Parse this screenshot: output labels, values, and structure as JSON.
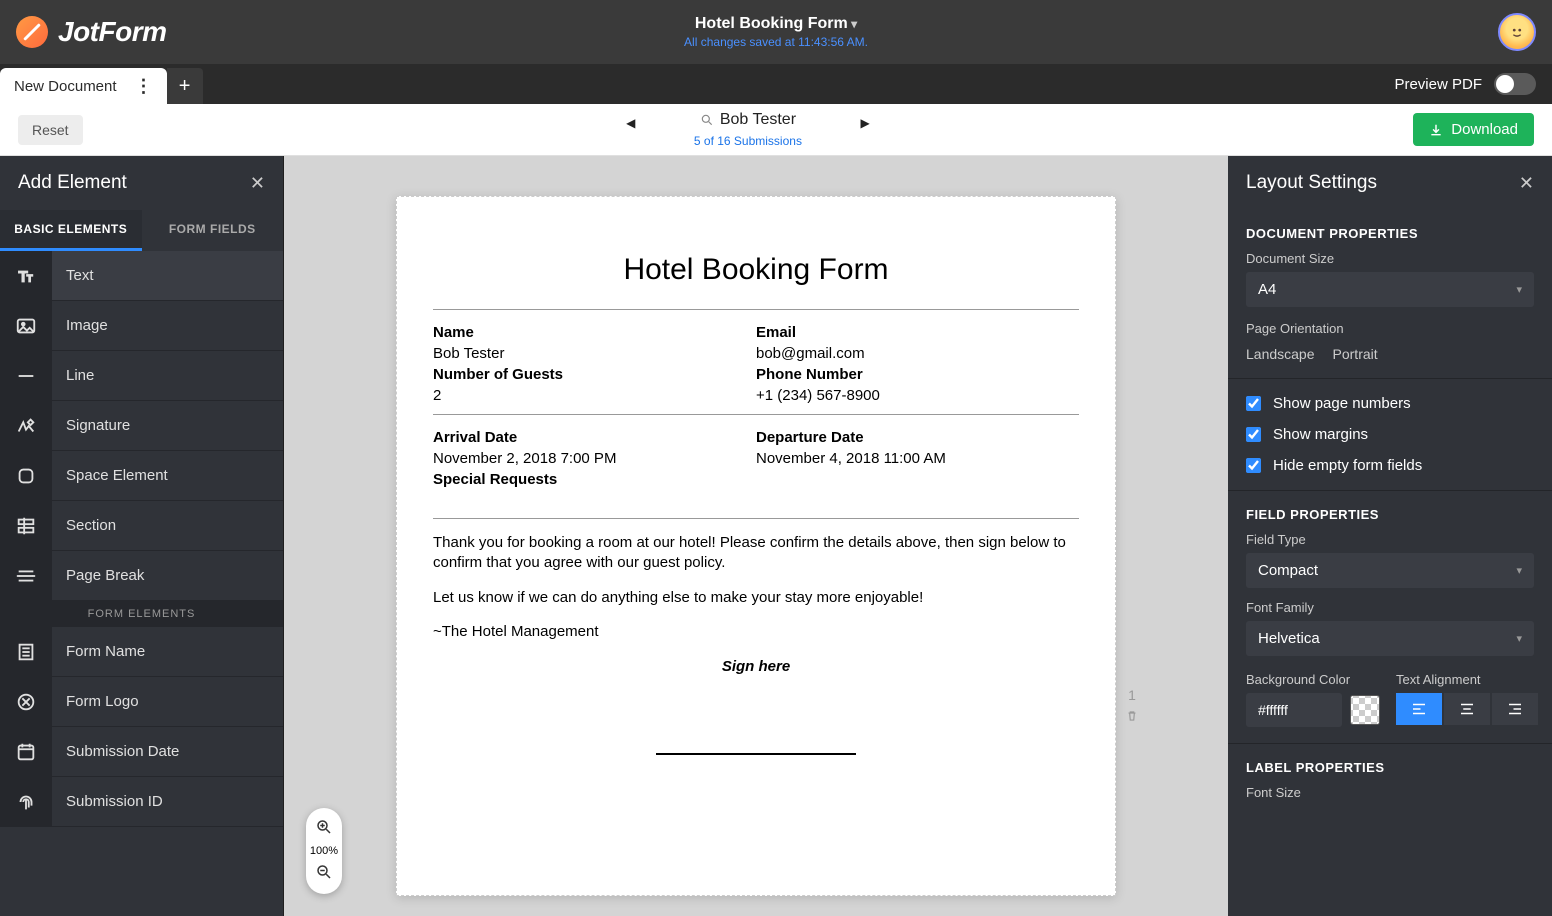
{
  "header": {
    "brand": "JotForm",
    "form_title": "Hotel Booking Form",
    "save_status": "All changes saved at 11:43:56 AM."
  },
  "tabs": {
    "doc_tab": "New Document",
    "preview_label": "Preview PDF"
  },
  "toolbar": {
    "reset_label": "Reset",
    "current_submission": "Bob Tester",
    "submission_counter": "5 of 16 Submissions",
    "download_label": "Download"
  },
  "left": {
    "title": "Add Element",
    "tab_basic": "BASIC ELEMENTS",
    "tab_fields": "FORM FIELDS",
    "divider": "FORM ELEMENTS",
    "items": [
      {
        "label": "Text"
      },
      {
        "label": "Image"
      },
      {
        "label": "Line"
      },
      {
        "label": "Signature"
      },
      {
        "label": "Space Element"
      },
      {
        "label": "Section"
      },
      {
        "label": "Page Break"
      }
    ],
    "form_items": [
      {
        "label": "Form Name"
      },
      {
        "label": "Form Logo"
      },
      {
        "label": "Submission Date"
      },
      {
        "label": "Submission ID"
      }
    ]
  },
  "right": {
    "title": "Layout Settings",
    "doc_props_title": "DOCUMENT PROPERTIES",
    "doc_size_label": "Document Size",
    "doc_size_value": "A4",
    "orientation_label": "Page Orientation",
    "orient_landscape": "Landscape",
    "orient_portrait": "Portrait",
    "show_pagenum": "Show page numbers",
    "show_margins": "Show margins",
    "hide_empty": "Hide empty form fields",
    "field_props_title": "FIELD PROPERTIES",
    "field_type_label": "Field Type",
    "field_type_value": "Compact",
    "font_family_label": "Font Family",
    "font_family_value": "Helvetica",
    "bg_color_label": "Background Color",
    "bg_color_value": "#ffffff",
    "text_align_label": "Text Alignment",
    "label_props_title": "LABEL PROPERTIES",
    "font_size_label": "Font Size"
  },
  "zoom": {
    "pct": "100%"
  },
  "page_side": {
    "page_num": "1"
  },
  "document": {
    "title": "Hotel Booking Form",
    "name_label": "Name",
    "name_value": "Bob Tester",
    "email_label": "Email",
    "email_value": "bob@gmail.com",
    "guests_label": "Number of Guests",
    "guests_value": "2",
    "phone_label": "Phone Number",
    "phone_value": "+1 (234) 567-8900",
    "arrival_label": "Arrival Date",
    "arrival_value": "November 2, 2018 7:00 PM",
    "departure_label": "Departure Date",
    "departure_value": "November 4, 2018 11:00 AM",
    "special_label": "Special Requests",
    "body1": "Thank you for booking a room at our hotel! Please confirm the details above, then sign below to confirm that you agree with our guest policy.",
    "body2": "Let us know if we can do anything else to make your stay more enjoyable!",
    "body3": "~The Hotel Management",
    "sign_here": "Sign here"
  }
}
